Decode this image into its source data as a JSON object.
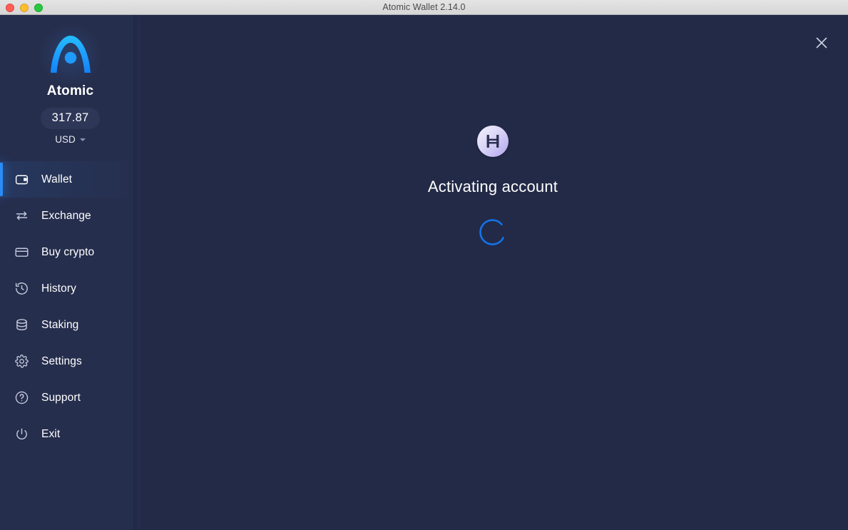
{
  "window": {
    "title": "Atomic Wallet 2.14.0",
    "traffic_lights": {
      "close_label": "close",
      "minimize_label": "minimize",
      "maximize_label": "maximize"
    }
  },
  "sidebar": {
    "brand_name": "Atomic",
    "brand_logo": "atomic-logo",
    "balance": "317.87",
    "currency": "USD",
    "currency_caret": "chevron-down-icon",
    "items": [
      {
        "label": "Wallet",
        "icon": "wallet-icon",
        "active": true
      },
      {
        "label": "Exchange",
        "icon": "exchange-icon",
        "active": false
      },
      {
        "label": "Buy crypto",
        "icon": "credit-card-icon",
        "active": false
      },
      {
        "label": "History",
        "icon": "history-icon",
        "active": false
      },
      {
        "label": "Staking",
        "icon": "database-icon",
        "active": false
      },
      {
        "label": "Settings",
        "icon": "gear-icon",
        "active": false
      },
      {
        "label": "Support",
        "icon": "question-icon",
        "active": false
      },
      {
        "label": "Exit",
        "icon": "power-icon",
        "active": false
      }
    ]
  },
  "main": {
    "close_icon": "close-icon",
    "coin_icon": "hedera-hbar-icon",
    "status_title": "Activating account",
    "spinner": "loading-spinner"
  },
  "colors": {
    "accent_blue": "#2b8bf7",
    "sidebar_bg": "#262e4d",
    "main_bg": "#222a47",
    "pill_bg": "#2e3758",
    "text_primary": "#ffffff",
    "icon_muted": "#c5cade",
    "coin_purple": "#b0a5ee",
    "titlebar_bg": "#dcdcdc"
  }
}
